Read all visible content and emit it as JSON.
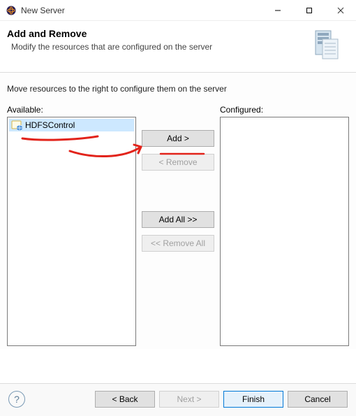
{
  "window": {
    "title": "New Server"
  },
  "banner": {
    "title": "Add and Remove",
    "description": "Modify the resources that are configured on the server"
  },
  "instruction": "Move resources to the right to configure them on the server",
  "available": {
    "label": "Available:",
    "items": [
      {
        "label": "HDFSControl"
      }
    ]
  },
  "configured": {
    "label": "Configured:"
  },
  "buttons": {
    "add": "Add >",
    "remove": "< Remove",
    "addAll": "Add All >>",
    "removeAll": "<< Remove All"
  },
  "footer": {
    "back": "< Back",
    "next": "Next >",
    "finish": "Finish",
    "cancel": "Cancel"
  }
}
